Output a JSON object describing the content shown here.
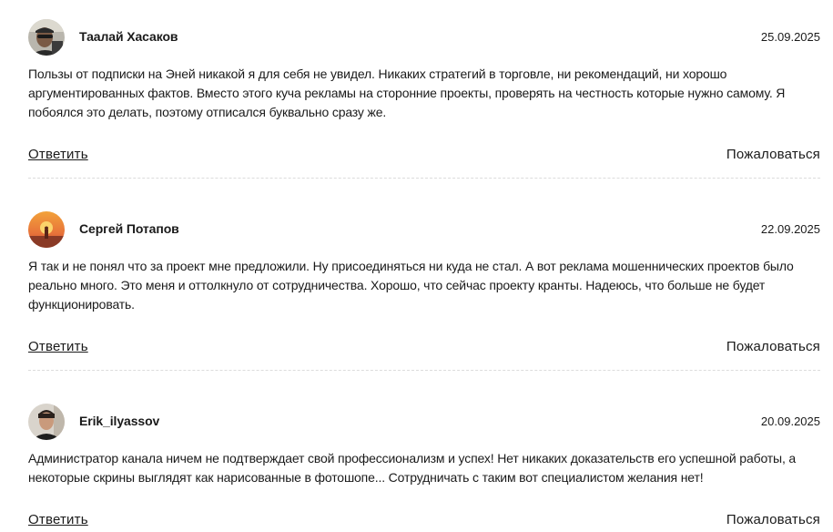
{
  "comments": [
    {
      "author": "Таалай Хасаков",
      "date": "25.09.2025",
      "text": "Пользы от подписки на Эней никакой я для себя не увидел. Никаких стратегий в торговле, ни рекомендаций, ни хорошо аргументированных фактов. Вместо этого куча рекламы на сторонние проекты, проверять на честность которые нужно самому. Я побоялся это делать, поэтому отписался буквально сразу же.",
      "reply_label": "Ответить",
      "report_label": "Пожаловаться",
      "avatar": "person-selfie-avatar"
    },
    {
      "author": "Сергей Потапов",
      "date": "22.09.2025",
      "text": "Я так и не понял что за проект мне предложили. Ну присоединяться ни куда не стал. А вот реклама мошеннических проектов было реально много. Это меня и оттолкнуло от сотрудничества. Хорошо, что сейчас проекту кранты. Надеюсь, что больше не будет функционировать.",
      "reply_label": "Ответить",
      "report_label": "Пожаловаться",
      "avatar": "sunset-silhouette-avatar"
    },
    {
      "author": "Erik_ilyassov",
      "date": "20.09.2025",
      "text": "Администратор канала ничем не подтверждает свой профессионализм и успех! Нет никаких доказательств его успешной работы, а некоторые скрины выглядят как нарисованные в фотошопе... Сотрудничать с таким вот специалистом желания нет!",
      "reply_label": "Ответить",
      "report_label": "Пожаловаться",
      "avatar": "man-portrait-avatar"
    }
  ]
}
